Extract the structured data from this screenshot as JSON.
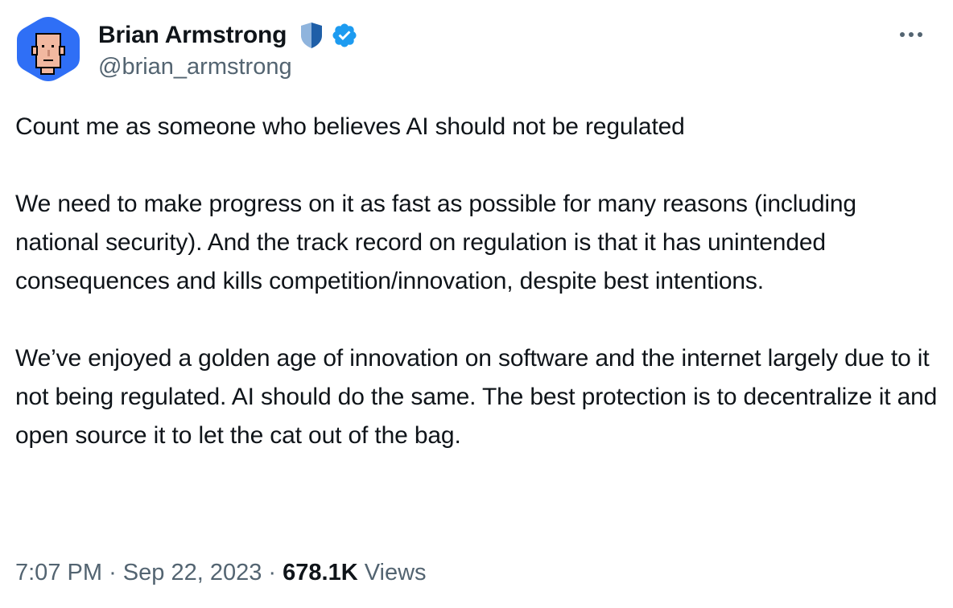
{
  "author": {
    "name": "Brian Armstrong",
    "handle": "@brian_armstrong",
    "avatar_icon": "pixel-face-avatar-icon",
    "affiliate_badge_icon": "shield-icon",
    "verified_badge_icon": "verified-check-icon"
  },
  "menu": {
    "more_icon": "more-dots-icon"
  },
  "tweet": {
    "paragraphs": [
      "Count me as someone who believes AI should not be regulated",
      "We need to make progress on it as fast as possible for many reasons (including national security). And the track record on regulation is that it has unintended consequences and kills competition/innovation, despite best intentions.",
      "We’ve enjoyed a golden age of innovation on software and the internet largely due to it not being regulated. AI should do the same. The best protection is to decentralize it and open source it to let the cat out of the bag."
    ]
  },
  "meta": {
    "time": "7:07 PM",
    "separator": "·",
    "date": "Sep 22, 2023",
    "views_count": "678.1K",
    "views_label": "Views"
  },
  "colors": {
    "text": "#0f1419",
    "secondary": "#536471",
    "verified_blue": "#1d9bf0",
    "avatar_bg": "#2f6ff6"
  }
}
